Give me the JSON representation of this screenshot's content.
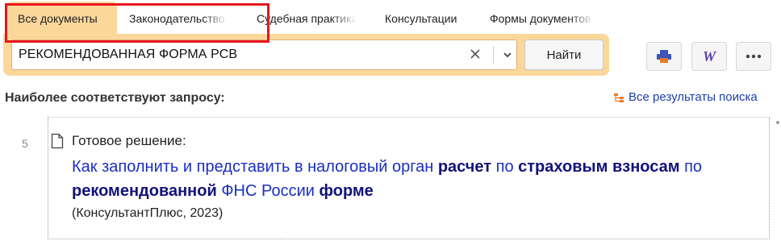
{
  "tabs": [
    {
      "label": "Все документы",
      "active": true
    },
    {
      "label": "Законодательство"
    },
    {
      "label": "Судебная практика"
    },
    {
      "label": "Консультации"
    },
    {
      "label": "Формы документов"
    }
  ],
  "search": {
    "value": "РЕКОМЕНДОВАННАЯ ФОРМА РСВ",
    "find_label": "Найти"
  },
  "toolbar": {
    "print_icon": "printer-icon",
    "word_icon": "word-export-icon",
    "more_icon": "more-icon"
  },
  "section": {
    "title": "Наиболее соответствуют запросу:",
    "all_results_label": "Все результаты поиска"
  },
  "result": {
    "number": "5",
    "type_label": "Готовое решение:",
    "link_parts": [
      "Как заполнить и представить в налоговый орган ",
      "расчет",
      " по ",
      "страховым",
      " ",
      "взносам",
      " по ",
      "рекомендованной",
      " ФНС России ",
      "форме"
    ],
    "source": "(КонсультантПлюс, 2023)"
  },
  "colors": {
    "accent": "#fbd79a",
    "highlight_border": "#e8151e",
    "link": "#1a2ec4"
  }
}
